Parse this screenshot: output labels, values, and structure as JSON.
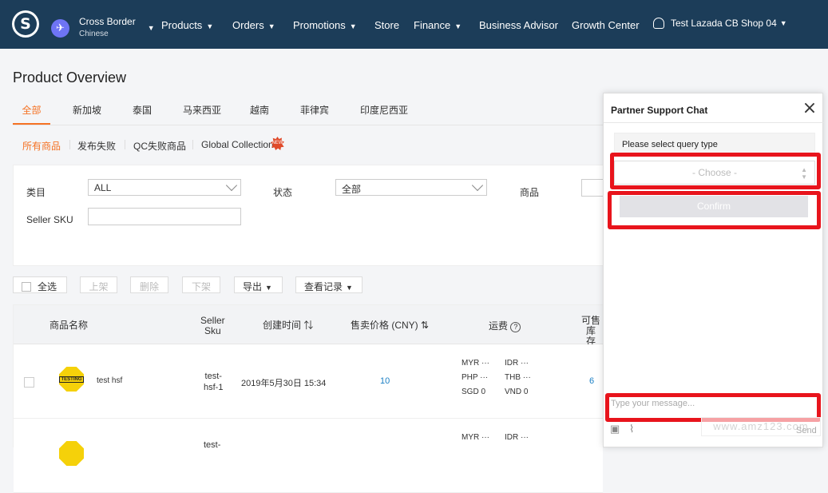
{
  "header": {
    "region": {
      "name": "Cross Border",
      "sub": "Chinese"
    },
    "nav": [
      {
        "label": "Products",
        "dropdown": true
      },
      {
        "label": "Orders",
        "dropdown": true
      },
      {
        "label": "Promotions",
        "dropdown": true
      },
      {
        "label": "Store",
        "dropdown": false
      },
      {
        "label": "Finance",
        "dropdown": true
      },
      {
        "label": "Business Advisor",
        "dropdown": false
      },
      {
        "label": "Growth Center",
        "dropdown": false
      }
    ],
    "user": "Test Lazada CB Shop 04",
    "logo_letter": "S",
    "bg_color": "#1c3d59"
  },
  "page": {
    "title": "Product Overview",
    "tabs": [
      "全部",
      "新加坡",
      "泰国",
      "马来西亚",
      "越南",
      "菲律宾",
      "印度尼西亚"
    ],
    "active_tab": "全部",
    "subtabs": [
      "所有商品",
      "发布失败",
      "QC失败商品",
      "Global Collection"
    ],
    "badge": "NEW",
    "accent_color": "#f57224"
  },
  "filters": {
    "category_label": "类目",
    "category_value": "ALL",
    "status_label": "状态",
    "status_value": "全部",
    "product_label": "商品",
    "seller_sku_label": "Seller SKU"
  },
  "actions": {
    "select_all": "全选",
    "online": "上架",
    "delete": "删除",
    "offline": "下架",
    "export": "导出",
    "history": "查看记录"
  },
  "table": {
    "headers": {
      "product_name": "商品名称",
      "seller_sku_1": "Seller",
      "seller_sku_2": "Sku",
      "created": "创建时间",
      "price": "售卖价格 (CNY)",
      "shipping": "运费",
      "stock_1": "可售库",
      "stock_2": "存"
    },
    "rows": [
      {
        "name": "test hsf",
        "image_text": "TESTING",
        "sku_1": "test-",
        "sku_2": "hsf-1",
        "created": "2019年5月30日 15:34",
        "price": "10",
        "stock": "6",
        "ship": [
          "MYR ···",
          "IDR ···",
          "PHP ···",
          "THB ···",
          "SGD 0",
          "VND 0"
        ]
      },
      {
        "sku_1": "test-",
        "ship": [
          "MYR ···",
          "IDR ···"
        ]
      }
    ]
  },
  "chat": {
    "title": "Partner Support Chat",
    "query_label": "Please select query type",
    "choose_placeholder": "- Choose -",
    "confirm": "Confirm",
    "message_placeholder": "Type your message...",
    "send": "Send",
    "watermark": "www.amz123.com",
    "highlight_color": "#e8141c"
  }
}
